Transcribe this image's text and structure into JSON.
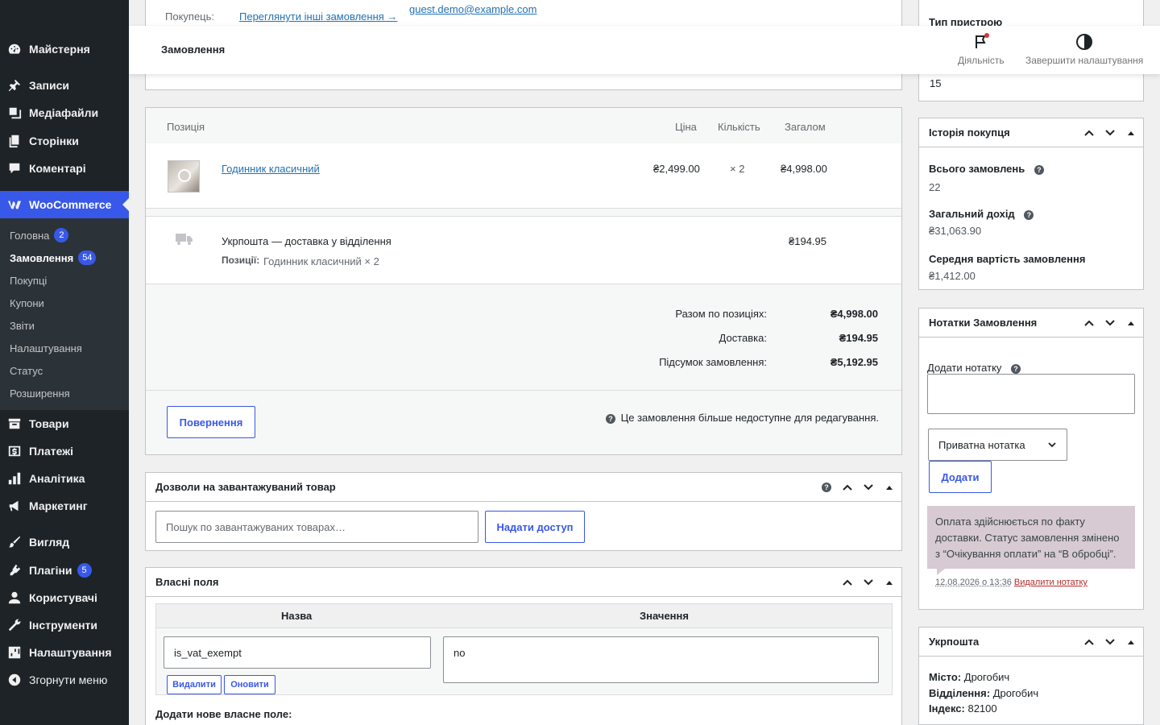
{
  "sidebar": {
    "items": [
      {
        "label": "Майстерня",
        "icon": "dashboard-icon"
      },
      {
        "label": "Записи",
        "icon": "pin-icon"
      },
      {
        "label": "Медіафайли",
        "icon": "media-icon"
      },
      {
        "label": "Сторінки",
        "icon": "page-icon"
      },
      {
        "label": "Коментарі",
        "icon": "comment-icon"
      },
      {
        "label": "WooCommerce",
        "icon": "woocommerce-icon"
      },
      {
        "label": "Товари",
        "icon": "archive-icon"
      },
      {
        "label": "Платежі",
        "icon": "dollar-icon"
      },
      {
        "label": "Аналітика",
        "icon": "bar-chart-icon"
      },
      {
        "label": "Маркетинг",
        "icon": "megaphone-icon"
      },
      {
        "label": "Вигляд",
        "icon": "brush-icon"
      },
      {
        "label": "Плагіни",
        "icon": "plugin-icon",
        "badge": "5"
      },
      {
        "label": "Користувачі",
        "icon": "user-icon"
      },
      {
        "label": "Інструменти",
        "icon": "wrench-icon"
      },
      {
        "label": "Налаштування",
        "icon": "settings-icon"
      },
      {
        "label": "Згорнути меню",
        "icon": "collapse-icon"
      }
    ],
    "submenu": [
      {
        "label": "Головна",
        "badge": "2"
      },
      {
        "label": "Замовлення",
        "badge": "54"
      },
      {
        "label": "Покупці"
      },
      {
        "label": "Купони"
      },
      {
        "label": "Звіти"
      },
      {
        "label": "Налаштування"
      },
      {
        "label": "Статус"
      },
      {
        "label": "Розширення"
      }
    ]
  },
  "header": {
    "title": "Замовлення",
    "activity_label": "Діяльність",
    "finish_setup_label": "Завершити налаштування"
  },
  "customer_panel": {
    "buyer_label": "Покупець:",
    "other_orders_link": "Переглянути інші замовлення →",
    "email": "guest.demo@example.com"
  },
  "items_panel": {
    "columns": {
      "item": "Позиція",
      "price": "Ціна",
      "qty": "Кількість",
      "total": "Загалом"
    },
    "product": {
      "name": "Годинник класичний",
      "price": "₴2,499.00",
      "qty": "× 2",
      "total": "₴4,998.00"
    },
    "shipping": {
      "name": "Укрпошта — доставка у відділення",
      "items_label": "Позиції:",
      "items_value": "Годинник класичний × 2",
      "total": "₴194.95"
    },
    "totals": [
      {
        "label": "Разом по позиціях:",
        "value": "₴4,998.00"
      },
      {
        "label": "Доставка:",
        "value": "₴194.95"
      },
      {
        "label": "Підсумок замовлення:",
        "value": "₴5,192.95"
      }
    ],
    "refund_button": "Повернення",
    "locked_notice": "Це замовлення більше недоступне для редагування."
  },
  "downloads_panel": {
    "title": "Дозволи на завантажуваний товар",
    "search_placeholder": "Пошук по завантажуваних товарах…",
    "grant_button": "Надати доступ"
  },
  "custom_fields_panel": {
    "title": "Власні поля",
    "col_name": "Назва",
    "col_value": "Значення",
    "field_name": "is_vat_exempt",
    "field_value": "no",
    "delete_button": "Видалити",
    "update_button": "Оновити",
    "add_new_label": "Додати нове власне поле:"
  },
  "device_panel": {
    "label": "Тип пристрою",
    "value": "15"
  },
  "history_panel": {
    "title": "Історія покупця",
    "stats": [
      {
        "label": "Всього замовлень",
        "value": "22"
      },
      {
        "label": "Загальний дохід",
        "value": "₴31,063.90"
      },
      {
        "label": "Середня вартість замовлення",
        "value": "₴1,412.00"
      }
    ]
  },
  "notes_panel": {
    "title": "Нотатки Замовлення",
    "add_note_label": "Додати нотатку",
    "note_type": "Приватна нотатка",
    "add_button": "Додати",
    "note_text": "Оплата здійснюється по факту доставки. Статус замовлення змінено з “Очікування оплати” на “В обробці”.",
    "note_date": "12.08.2026 о 13:36",
    "delete_note_link": "Видалити нотатку"
  },
  "ukrposhta_panel": {
    "title": "Укрпошта",
    "city_label": "Місто:",
    "city": "Дрогобич",
    "branch_label": "Відділення:",
    "branch": "Дрогобич",
    "index_label": "Індекс:",
    "index": "82100"
  },
  "colors": {
    "accent": "#3858e9",
    "sidebar": "#1d2327",
    "note_bg": "#d7cad2"
  }
}
